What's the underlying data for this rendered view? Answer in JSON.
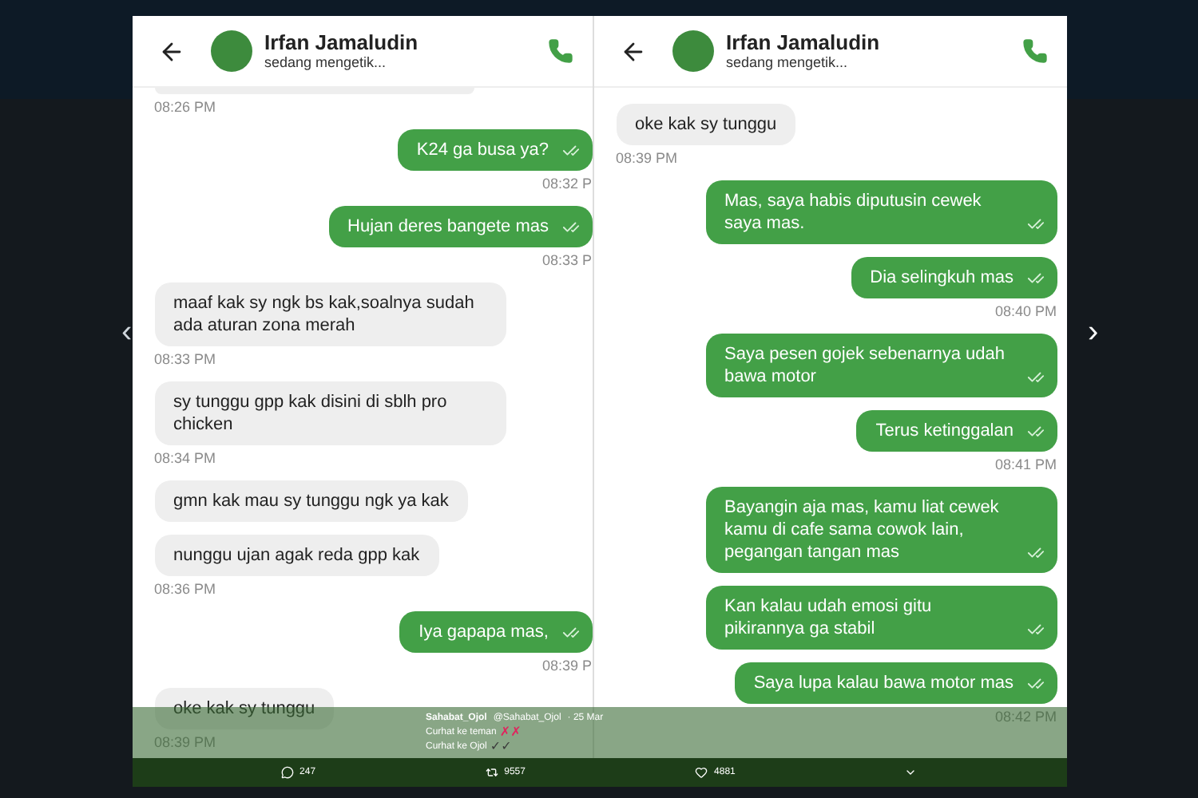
{
  "viewer": {
    "prev": "‹",
    "next": "›"
  },
  "panels": [
    {
      "contact": {
        "name": "Irfan Jamaludin",
        "status": "sedang mengetik..."
      },
      "messages": [
        {
          "kind": "received_cut",
          "time": "08:26 PM"
        },
        {
          "kind": "sent",
          "text": "K24 ga busa ya?",
          "read": true,
          "time": "08:32 P"
        },
        {
          "kind": "sent",
          "text": "Hujan deres bangete mas",
          "read": true,
          "time": "08:33 P"
        },
        {
          "kind": "received",
          "text": "maaf kak sy ngk bs kak,soalnya sudah ada aturan zona merah",
          "time": "08:33 PM"
        },
        {
          "kind": "received",
          "text": "sy tunggu gpp kak disini di sblh pro chicken",
          "time": "08:34 PM"
        },
        {
          "kind": "received",
          "text": "gmn kak mau sy tunggu ngk ya kak"
        },
        {
          "kind": "received",
          "text": "nunggu ujan agak reda gpp kak",
          "time": "08:36 PM"
        },
        {
          "kind": "sent",
          "text": "Iya gapapa mas,",
          "read": true,
          "time": "08:39 P"
        },
        {
          "kind": "received",
          "text": "oke kak sy tunggu",
          "time": "08:39 PM"
        }
      ]
    },
    {
      "contact": {
        "name": "Irfan Jamaludin",
        "status": "sedang mengetik..."
      },
      "messages": [
        {
          "kind": "received",
          "text": "oke kak sy tunggu",
          "time": "08:39 PM"
        },
        {
          "kind": "sent",
          "text": "Mas, saya habis diputusin cewek saya mas.",
          "read": true
        },
        {
          "kind": "sent",
          "text": "Dia selingkuh mas",
          "read": true,
          "time": "08:40 PM"
        },
        {
          "kind": "sent",
          "text": "Saya pesen gojek sebenarnya udah bawa motor",
          "read": true
        },
        {
          "kind": "sent",
          "text": "Terus ketinggalan",
          "read": true,
          "time": "08:41 PM"
        },
        {
          "kind": "sent",
          "text": "Bayangin aja mas, kamu liat cewek kamu di cafe sama cowok lain, pegangan tangan mas",
          "read": true
        },
        {
          "kind": "sent",
          "text": "Kan kalau udah emosi gitu pikirannya ga stabil",
          "read": true
        },
        {
          "kind": "sent",
          "text": "Saya lupa kalau bawa motor mas",
          "read": true,
          "time": "08:42 PM"
        }
      ]
    }
  ],
  "tweet": {
    "author": "Sahabat_Ojol",
    "handle": "@Sahabat_Ojol",
    "date": "· 25 Mar",
    "lines": [
      {
        "text": "Curhat ke teman",
        "marks": "✗✗",
        "color": "#e0245e"
      },
      {
        "text": "Curhat ke Ojol",
        "marks": "✓✓",
        "color": "#3a3a3a"
      }
    ]
  },
  "actions": [
    {
      "kind": "reply",
      "count": "247"
    },
    {
      "kind": "retweet",
      "count": "9557"
    },
    {
      "kind": "like",
      "count": "4881"
    },
    {
      "kind": "more"
    }
  ]
}
